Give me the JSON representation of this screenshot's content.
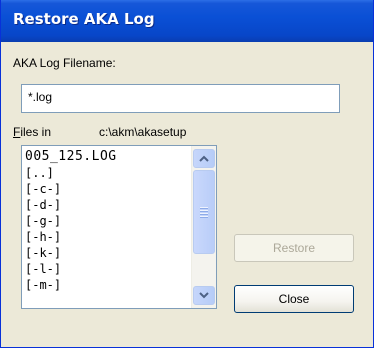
{
  "window": {
    "title": "Restore AKA Log"
  },
  "form": {
    "filename_label": "AKA Log Filename:",
    "filename_value": "*.log",
    "files_in_label_accel": "F",
    "files_in_label_rest": "iles in",
    "directory_path": "c:\\akm\\akasetup"
  },
  "file_list": {
    "items": [
      "005_125.LOG",
      "[..]",
      "[-c-]",
      "[-d-]",
      "[-g-]",
      "[-h-]",
      "[-k-]",
      "[-l-]",
      "[-m-]"
    ],
    "scroll_position": 0.0
  },
  "buttons": {
    "restore_label": "Restore",
    "restore_enabled": false,
    "close_label": "Close"
  },
  "colors": {
    "titlebar": "#0a50d6",
    "dialog_background": "#ece9d8",
    "disabled_text": "#aca899"
  },
  "icons": {
    "scroll_up": "chevron-up-icon",
    "scroll_down": "chevron-down-icon"
  }
}
